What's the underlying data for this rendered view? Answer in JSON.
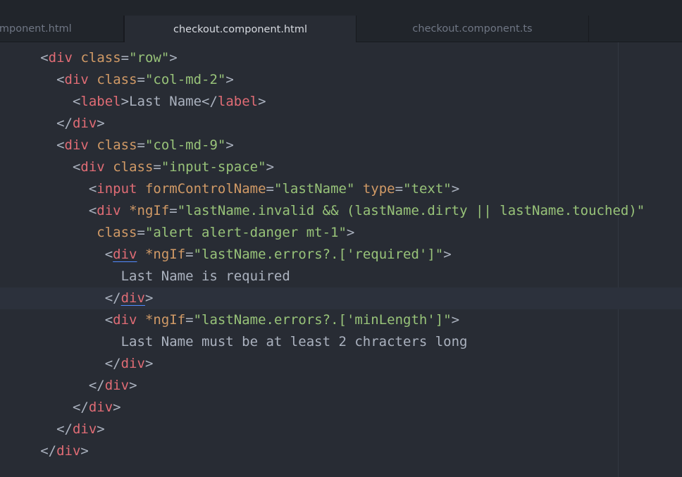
{
  "tabs": [
    {
      "label": "omponent.html",
      "active": false
    },
    {
      "label": "checkout.component.html",
      "active": true
    },
    {
      "label": "checkout.component.ts",
      "active": false
    },
    {
      "label": "",
      "active": false
    }
  ],
  "colors": {
    "background": "#282c34",
    "tab_bar": "#21252b",
    "tag": "#e06c75",
    "attribute": "#d19a66",
    "string": "#98c379",
    "text": "#abb2bf",
    "bracket_match_underline": "#528bff"
  },
  "code": {
    "l1": {
      "ind": "     ",
      "a": "<",
      "b": "div",
      "c": " ",
      "d": "class",
      "e": "=",
      "f": "\"row\"",
      "g": ">"
    },
    "l2": {
      "ind": "       ",
      "a": "<",
      "b": "div",
      "c": " ",
      "d": "class",
      "e": "=",
      "f": "\"col-md-2\"",
      "g": ">"
    },
    "l3": {
      "ind": "         ",
      "a": "<",
      "b": "label",
      "c": ">",
      "d": "Last Name",
      "e": "</",
      "f": "label",
      "g": ">"
    },
    "l4": {
      "ind": "       ",
      "a": "</",
      "b": "div",
      "c": ">"
    },
    "l5": {
      "ind": "       ",
      "a": "<",
      "b": "div",
      "c": " ",
      "d": "class",
      "e": "=",
      "f": "\"col-md-9\"",
      "g": ">"
    },
    "l6": {
      "ind": "         ",
      "a": "<",
      "b": "div",
      "c": " ",
      "d": "class",
      "e": "=",
      "f": "\"input-space\"",
      "g": ">"
    },
    "l7": {
      "ind": "           ",
      "a": "<",
      "b": "input",
      "c": " ",
      "d": "formControlName",
      "e": "=",
      "f": "\"lastName\"",
      "g": " ",
      "h": "type",
      "i": "=",
      "j": "\"text\"",
      "k": ">"
    },
    "l8": {
      "ind": "           ",
      "a": "<",
      "b": "div",
      "c": " ",
      "d": "*ngIf",
      "e": "=",
      "f": "\"lastName.invalid && (lastName.dirty || lastName.touched)\""
    },
    "l9": {
      "ind": "            ",
      "d": "class",
      "e": "=",
      "f": "\"alert alert-danger mt-1\"",
      "g": ">"
    },
    "l10": {
      "ind": "             ",
      "a": "<",
      "b": "div",
      "c": " ",
      "d": "*ngIf",
      "e": "=",
      "f": "\"lastName.errors?.['required']\"",
      "g": ">"
    },
    "l11": {
      "ind": "               ",
      "t": "Last Name is required"
    },
    "l12": {
      "ind": "             ",
      "a": "</",
      "b": "div",
      "c": ">"
    },
    "l13": {
      "ind": "             ",
      "a": "<",
      "b": "div",
      "c": " ",
      "d": "*ngIf",
      "e": "=",
      "f": "\"lastName.errors?.['minLength']\"",
      "g": ">"
    },
    "l14": {
      "ind": "               ",
      "t": "Last Name must be at least 2 chracters long"
    },
    "l15": {
      "ind": "             ",
      "a": "</",
      "b": "div",
      "c": ">"
    },
    "l16": {
      "ind": "           ",
      "a": "</",
      "b": "div",
      "c": ">"
    },
    "l17": {
      "ind": "         ",
      "a": "</",
      "b": "div",
      "c": ">"
    },
    "l18": {
      "ind": "       ",
      "a": "</",
      "b": "div",
      "c": ">"
    },
    "l19": {
      "ind": "     ",
      "a": "</",
      "b": "div",
      "c": ">"
    }
  }
}
